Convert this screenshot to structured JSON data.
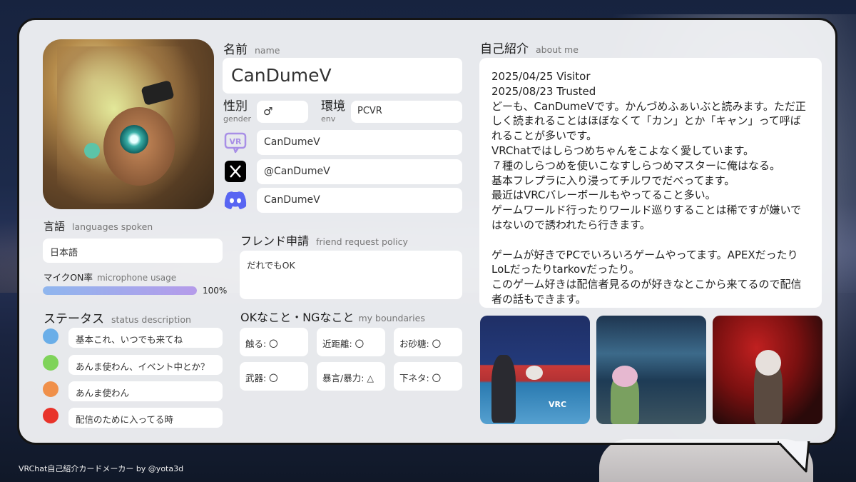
{
  "profile": {
    "name_label": "名前",
    "name_label_en": "name",
    "name": "CanDumeV",
    "gender_label": "性別",
    "gender_label_en": "gender",
    "gender": "♂",
    "env_label": "環境",
    "env_label_en": "env",
    "env": "PCVR",
    "accounts": [
      {
        "service": "vrchat-icon",
        "value": "CanDumeV"
      },
      {
        "service": "x-icon",
        "value": "@CanDumeV"
      },
      {
        "service": "discord-icon",
        "value": "CanDumeV"
      }
    ]
  },
  "languages": {
    "label": "言語",
    "label_en": "languages spoken",
    "value": "日本語"
  },
  "microphone": {
    "label": "マイクON率",
    "label_en": "microphone usage",
    "percent": 100,
    "percent_text": "100%"
  },
  "status": {
    "label": "ステータス",
    "label_en": "status description",
    "items": [
      {
        "color": "#6aaee8",
        "text": "基本これ、いつでも来てね"
      },
      {
        "color": "#7fd35a",
        "text": "あんま使わん、イベント中とか？"
      },
      {
        "color": "#f0904a",
        "text": "あんま使わん"
      },
      {
        "color": "#e8332a",
        "text": "配信のために入ってる時"
      }
    ]
  },
  "friend_request": {
    "label": "フレンド申請",
    "label_en": "friend request policy",
    "value": "だれでもOK"
  },
  "boundaries": {
    "label": "OKなこと・NGなこと",
    "label_en": "my boundaries",
    "items": [
      "触る: 〇",
      "近距離: 〇",
      "お砂糖: 〇",
      "武器: 〇",
      "暴言/暴力: △",
      "下ネタ: 〇"
    ]
  },
  "about": {
    "label": "自己紹介",
    "label_en": "about me",
    "text": "2025/04/25 Visitor\n2025/08/23 Trusted\nどーも、CanDumeVです。かんづめふぁいぶと読みます。ただ正しく読まれることはほぼなくて「カン」とか「キャン」って呼ばれることが多いです。\nVRChatではしらつめちゃんをこよなく愛しています。\n７種のしらつめを使いこなすしらつめマスターに俺はなる。\n基本フレプラに入り浸ってチルワでだべってます。\n最近はVRCバレーボールもやってること多い。\nゲームワールド行ったりワールド巡りすることは稀ですが嫌いではないので誘われたら行きます。\n\nゲームが好きでPCでいろいろゲームやってます。APEXだったりLoLだったりtarkovだったり。\nこのゲーム好きは配信者見るのが好きなとこから来てるので配信者の話もできます。"
  },
  "photo_text": {
    "scoreboard": "VRC"
  },
  "footer": {
    "credit": "VRChat自己紹介カードメーカー by @yota3d"
  }
}
